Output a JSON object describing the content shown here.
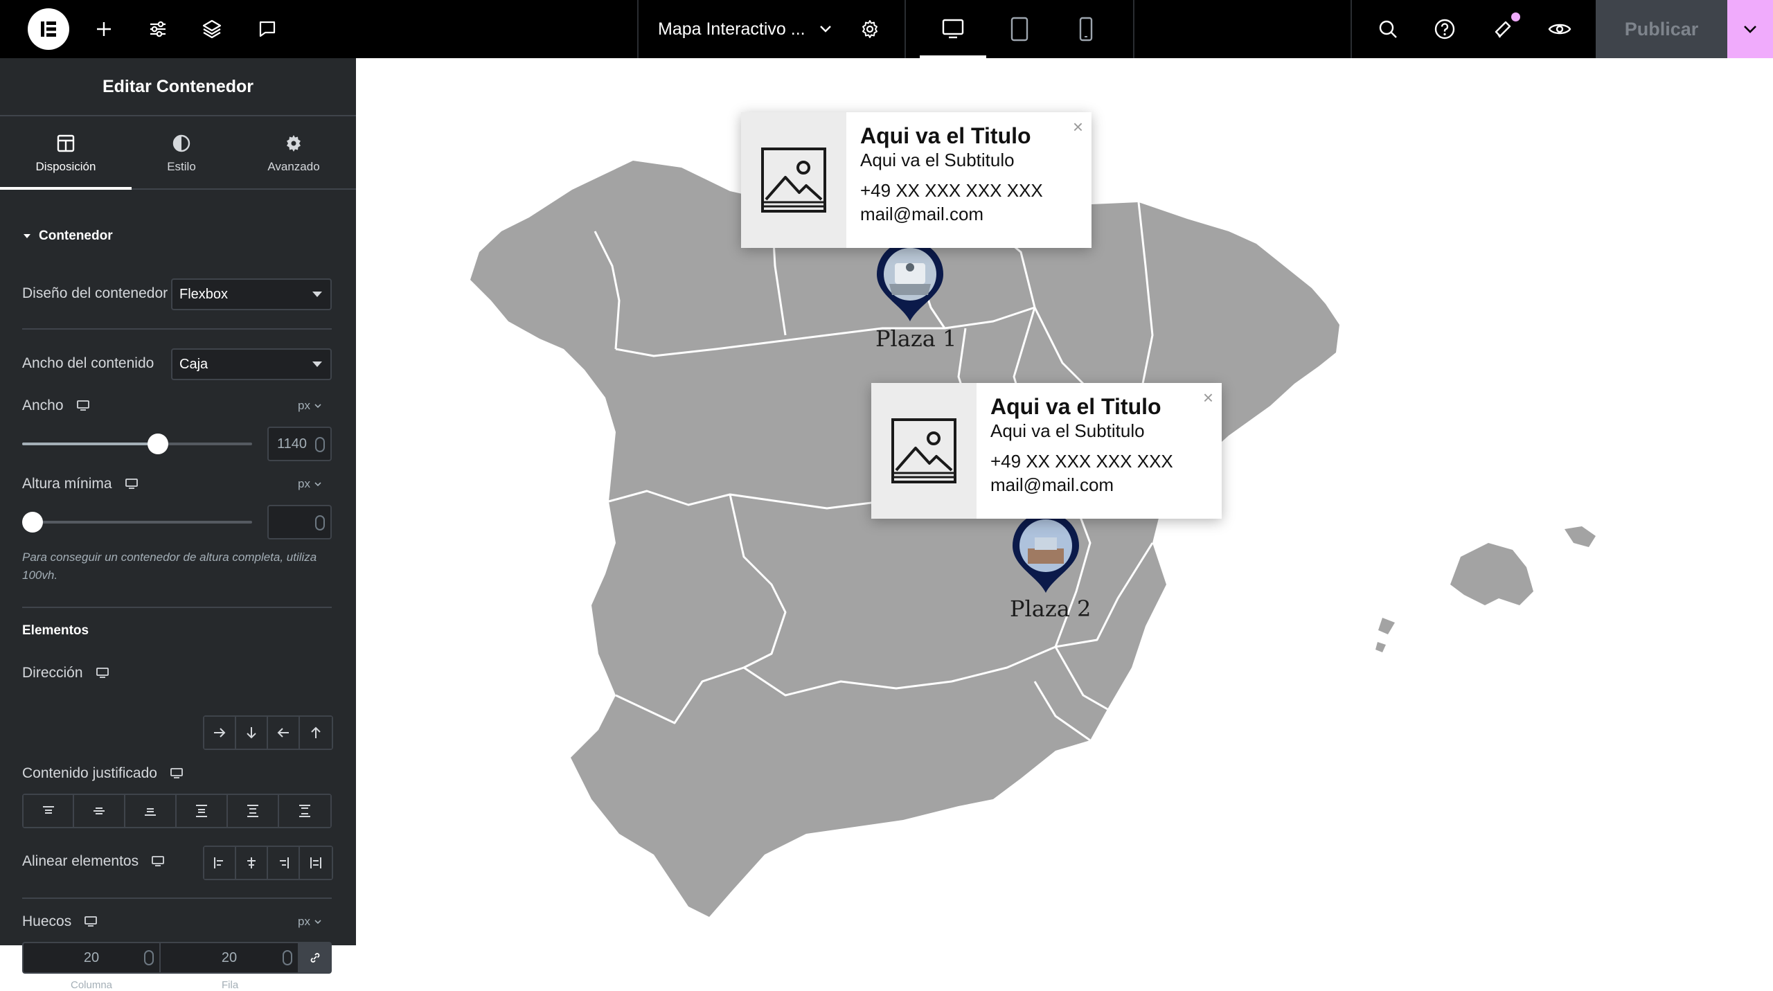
{
  "topbar": {
    "logo": "elementor-logo",
    "icons_left": [
      "plus-icon",
      "sliders-icon",
      "layers-icon",
      "comment-icon"
    ],
    "document_title": "Mapa Interactivo ...",
    "icons_device": [
      "desktop-icon",
      "tablet-icon",
      "mobile-icon"
    ],
    "active_device": "desktop",
    "icons_right": [
      "search-icon",
      "help-icon",
      "megaphone-icon",
      "eye-icon"
    ],
    "publish_label": "Publicar",
    "accent": "#f0abfc"
  },
  "panel": {
    "title": "Editar Contenedor",
    "tabs": [
      {
        "label": "Disposición",
        "icon": "layout-icon"
      },
      {
        "label": "Estilo",
        "icon": "contrast-icon"
      },
      {
        "label": "Avanzado",
        "icon": "gear-icon"
      }
    ],
    "active_tab": "Disposición",
    "section_container": "Contenedor",
    "container_layout_label": "Diseño del contenedor",
    "container_layout_value": "Flexbox",
    "content_width_label": "Ancho del contenido",
    "content_width_value": "Caja",
    "width_label": "Ancho",
    "width_unit": "px",
    "width_value": "1140",
    "width_slider_fraction": 0.6,
    "min_height_label": "Altura mínima",
    "min_height_unit": "px",
    "min_height_value": "",
    "min_height_slider_fraction": 0,
    "hint": "Para conseguir un contenedor de altura completa, utiliza 100vh.",
    "section_elements": "Elementos",
    "direction_label": "Dirección",
    "justify_label": "Contenido justificado",
    "align_label": "Alinear elementos",
    "gaps_label": "Huecos",
    "gaps_unit": "px",
    "gap_column_value": "20",
    "gap_row_value": "20",
    "gap_column_label": "Columna",
    "gap_row_label": "Fila"
  },
  "canvas": {
    "pins": [
      {
        "label": "Plaza 1"
      },
      {
        "label": "Plaza 2"
      }
    ],
    "cards": [
      {
        "title": "Aqui va el Titulo",
        "subtitle": "Aqui va el Subtitulo",
        "phone": "+49 XX XXX XXX XXX",
        "email": "mail@mail.com"
      },
      {
        "title": "Aqui va el Titulo",
        "subtitle": "Aqui va el Subtitulo",
        "phone": "+49 XX XXX XXX XXX",
        "email": "mail@mail.com"
      }
    ],
    "map_color": "#a3a3a3",
    "pin_color": "#0b1a4a"
  }
}
